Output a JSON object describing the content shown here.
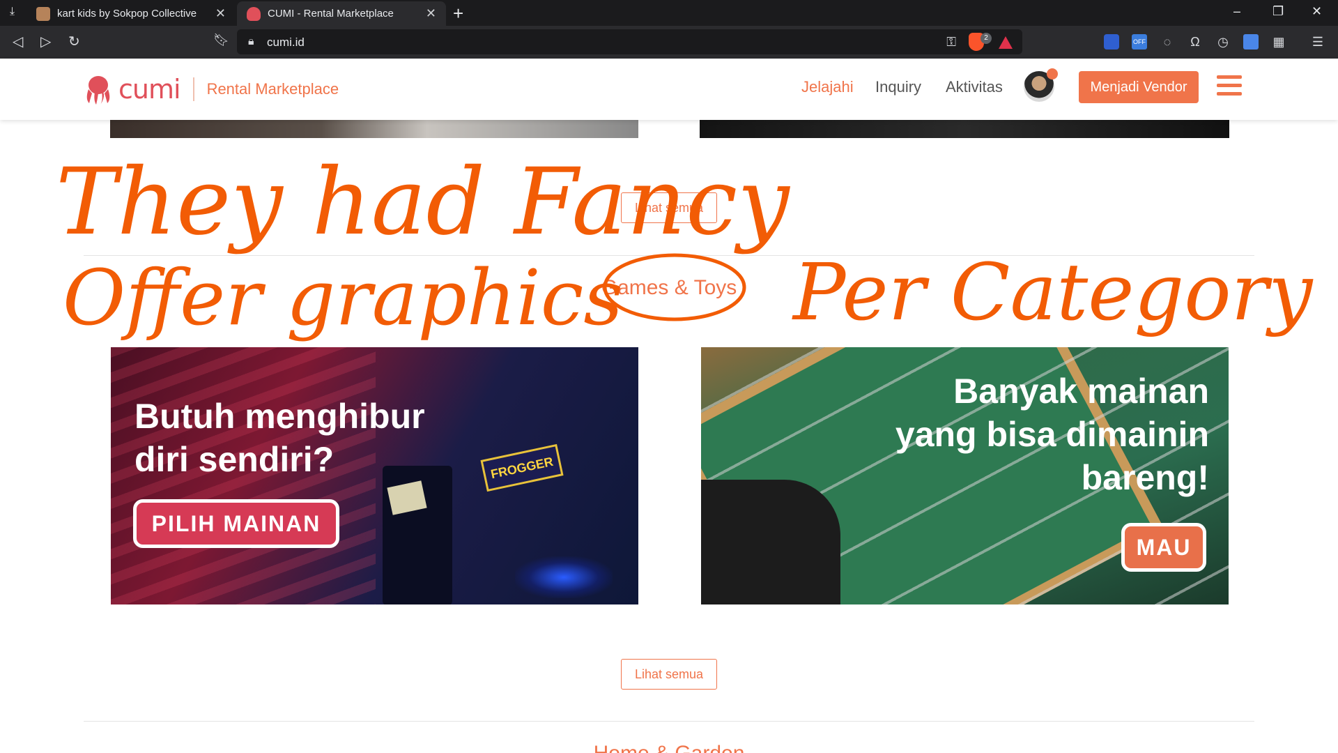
{
  "browser": {
    "tabs": [
      {
        "title": "kart kids by Sokpop Collective",
        "close": "✕"
      },
      {
        "title": "CUMI - Rental Marketplace",
        "close": "✕"
      }
    ],
    "new_tab": "+",
    "url": "cumi.id",
    "brave_badge": "2",
    "window_controls": [
      "–",
      "❐",
      "✕"
    ]
  },
  "site": {
    "brand": "cumi",
    "tagline": "Rental Marketplace",
    "nav": [
      "Jelajahi",
      "Inquiry",
      "Aktivitas"
    ],
    "vendor_button": "Menjadi Vendor",
    "accent_color": "#f0744a"
  },
  "content": {
    "see_all_1": "Lihat semua",
    "category_title": "Games & Toys",
    "banner_left": {
      "line1": "Butuh menghibur",
      "line2": "diri sendiri?",
      "button": "PILIH MAINAN",
      "sign_text": "FROGGER"
    },
    "banner_right": {
      "line1": "Banyak mainan",
      "line2": "yang bisa dimainin",
      "line3": "bareng!",
      "button": "MAU"
    },
    "see_all_2": "Lihat semua",
    "next_category_partial": "Home & Garden"
  },
  "annotation": {
    "line1": "They had Fancy",
    "line2": "Offer graphics",
    "line3": "Per  Category",
    "color": "#f25c05"
  }
}
